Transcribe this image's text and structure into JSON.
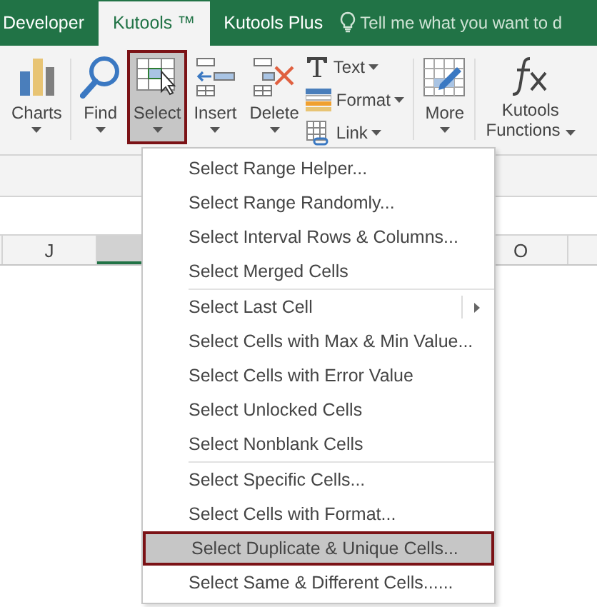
{
  "tabs": [
    {
      "label": "Developer",
      "selected": false
    },
    {
      "label": "Kutools ™",
      "selected": true
    },
    {
      "label": "Kutools Plus",
      "selected": false
    }
  ],
  "tell_me": {
    "placeholder": "Tell me what you want to d"
  },
  "ribbon": [
    {
      "kind": "big",
      "label": "Charts",
      "selected": false
    },
    {
      "kind": "big",
      "label": "Find",
      "selected": false
    },
    {
      "kind": "big",
      "label": "Select",
      "selected": true
    },
    {
      "kind": "big",
      "label": "Insert",
      "selected": false
    },
    {
      "kind": "big",
      "label": "Delete",
      "selected": false
    },
    {
      "kind": "small",
      "items": [
        "Text",
        "Format",
        "Link"
      ]
    },
    {
      "kind": "big",
      "label": "More",
      "selected": false
    },
    {
      "kind": "big",
      "label": "Kutools Functions",
      "selected": false
    }
  ],
  "columns": [
    {
      "label": "J",
      "selected": false
    },
    {
      "selected": true
    },
    {
      "label": "O",
      "selected": false
    }
  ],
  "menu": {
    "groups": [
      [
        {
          "kind": "item",
          "label": "Select Range Helper...",
          "selected": false
        },
        {
          "kind": "item",
          "label": "Select Range Randomly...",
          "selected": false
        },
        {
          "kind": "item",
          "label": "Select Interval Rows & Columns...",
          "selected": false
        },
        {
          "kind": "item",
          "label": "Select Merged Cells",
          "selected": false
        }
      ],
      [
        {
          "kind": "submenu",
          "label": "Select Last Cell",
          "selected": false
        },
        {
          "kind": "item",
          "label": "Select Cells with Max & Min Value...",
          "selected": false
        },
        {
          "kind": "item",
          "label": "Select Cells with Error Value",
          "selected": false
        },
        {
          "kind": "item",
          "label": "Select Unlocked Cells",
          "selected": false
        },
        {
          "kind": "item",
          "label": "Select Nonblank Cells",
          "selected": false
        }
      ],
      [
        {
          "kind": "item",
          "label": "Select Specific Cells...",
          "selected": false
        },
        {
          "kind": "item",
          "label": "Select Cells with Format...",
          "selected": false
        },
        {
          "kind": "item",
          "label": "Select Duplicate & Unique Cells...",
          "selected": true
        },
        {
          "kind": "item",
          "label": "Select Same & Different Cells......",
          "selected": false
        }
      ]
    ]
  }
}
